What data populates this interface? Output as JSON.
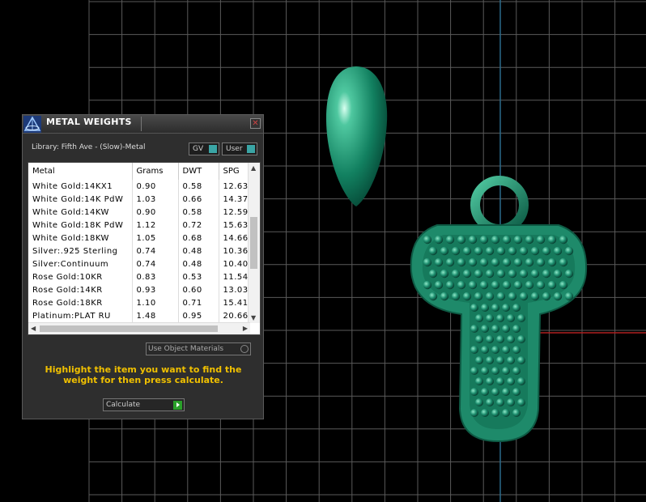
{
  "window": {
    "title": "METAL WEIGHTS",
    "close_glyph": "✕"
  },
  "library_label": "Library: Fifth Ave - (Slow)-Metal",
  "toggles": {
    "gv": "GV",
    "user": "User"
  },
  "table": {
    "columns": [
      "Metal",
      "Grams",
      "DWT",
      "SPG"
    ],
    "rows": [
      [
        "White Gold:14KX1",
        "0.90",
        "0.58",
        "12.63"
      ],
      [
        "White Gold:14K PdW",
        "1.03",
        "0.66",
        "14.37"
      ],
      [
        "White Gold:14KW",
        "0.90",
        "0.58",
        "12.59"
      ],
      [
        "White Gold:18K PdW",
        "1.12",
        "0.72",
        "15.63"
      ],
      [
        "White Gold:18KW",
        "1.05",
        "0.68",
        "14.66"
      ],
      [
        "Silver:.925 Sterling",
        "0.74",
        "0.48",
        "10.36"
      ],
      [
        "Silver:Continuum",
        "0.74",
        "0.48",
        "10.40"
      ],
      [
        "Rose Gold:10KR",
        "0.83",
        "0.53",
        "11.54"
      ],
      [
        "Rose Gold:14KR",
        "0.93",
        "0.60",
        "13.03"
      ],
      [
        "Rose Gold:18KR",
        "1.10",
        "0.71",
        "15.41"
      ],
      [
        "Platinum:PLAT RU",
        "1.48",
        "0.95",
        "20.66"
      ]
    ]
  },
  "use_object_materials": "Use Object Materials",
  "instructions": "Highlight the item you want to find the weight for then press calculate.",
  "calculate_label": "Calculate",
  "colors": {
    "accent_teal": "#3aa5a5",
    "instruction_yellow": "#f0c000",
    "model_green": "#1e8a6a",
    "axis_blue": "#2a6a8a",
    "axis_red": "#b02020"
  },
  "icons": {
    "app_logo": "pyramid-logo-icon",
    "close": "close-icon",
    "calculate": "play-arrow-icon"
  }
}
